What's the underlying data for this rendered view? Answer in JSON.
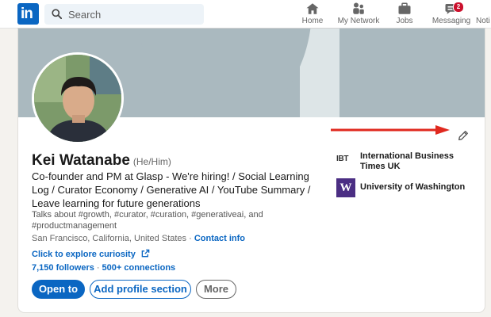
{
  "nav": {
    "logo_text": "in",
    "search_placeholder": "Search",
    "items": [
      {
        "label": "Home",
        "icon": "home-icon"
      },
      {
        "label": "My Network",
        "icon": "network-icon"
      },
      {
        "label": "Jobs",
        "icon": "briefcase-icon"
      },
      {
        "label": "Messaging",
        "icon": "messaging-icon",
        "badge": "2"
      },
      {
        "label": "Noti",
        "icon": "bell-icon"
      }
    ]
  },
  "profile": {
    "name": "Kei Watanabe",
    "pronouns": "(He/Him)",
    "headline": "Co-founder and PM at Glasp - We're hiring! / Social Learning Log / Curator Economy / Generative AI / YouTube Summary / Leave learning for future generations",
    "talks_about": "Talks about #growth, #curator, #curation, #generativeai, and #productmanagement",
    "location": "San Francisco, California, United States",
    "location_sep": "·",
    "contact_info": "Contact info",
    "explore_link": "Click to explore curiosity",
    "followers": "7,150 followers",
    "conn_sep": "·",
    "connections": "500+ connections"
  },
  "actions": {
    "open_to": "Open to",
    "add_section": "Add profile section",
    "more": "More"
  },
  "companies": [
    {
      "logo_text": "IBT",
      "name": "International Business Times UK"
    },
    {
      "logo_text": "W",
      "name": "University of Washington"
    }
  ],
  "colors": {
    "brand": "#0a66c2",
    "badge": "#cb112d",
    "arrow": "#e0291f",
    "uw_purple": "#4b2e83"
  }
}
